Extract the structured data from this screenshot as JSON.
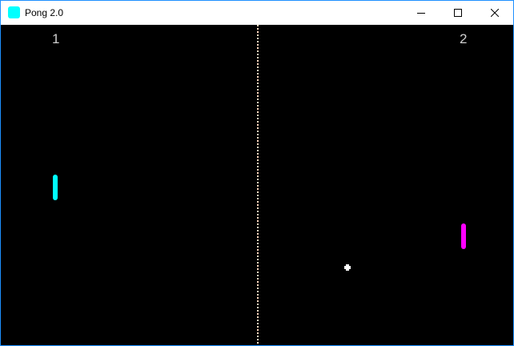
{
  "window": {
    "title": "Pong 2.0",
    "icon": "app-icon",
    "border_color": "#1e90ff",
    "controls": [
      "minimize-icon",
      "maximize-icon",
      "close-icon"
    ]
  },
  "game": {
    "background_color": "#000000",
    "center_line_color": "#ffd9c0",
    "player1": {
      "score": "1",
      "paddle_color": "#00ffff"
    },
    "player2": {
      "score": "2",
      "paddle_color": "#ff00ff"
    },
    "ball_color": "#ffffff"
  }
}
